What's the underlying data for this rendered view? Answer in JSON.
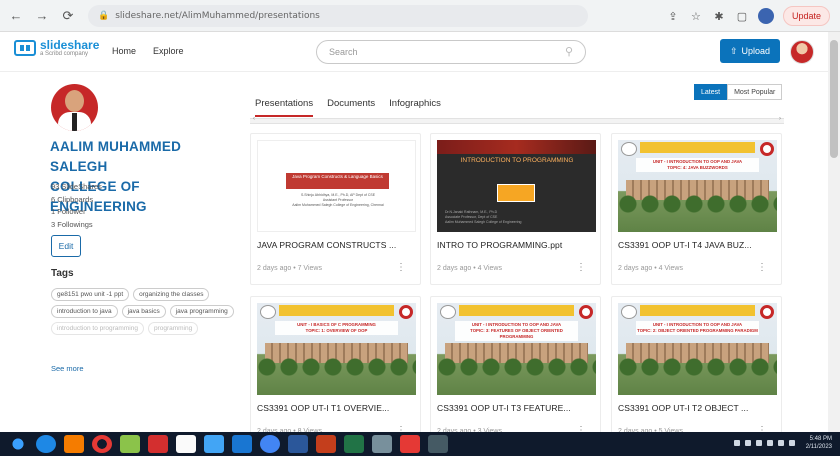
{
  "browser": {
    "url": "slideshare.net/AlimMuhammed/presentations",
    "update_label": "Update"
  },
  "header": {
    "logo_text": "slideshare",
    "logo_sub": "a Scribd company",
    "nav": [
      "Home",
      "Explore"
    ],
    "search_placeholder": "Search",
    "upload_label": "Upload"
  },
  "profile": {
    "name_line1": "AALIM MUHAMMED SALEGH",
    "name_line2": "COLLEGE OF ENGINEERING",
    "stats": [
      "93 SlideShares",
      "6 Clipboards",
      "1 Follower",
      "3 Followings"
    ],
    "edit_label": "Edit",
    "tags_title": "Tags",
    "tags": [
      "ge8151 pwo unit -1 ppt",
      "organizing the classes",
      "introduction to java",
      "java basics",
      "java programming",
      "introduction to programming",
      "programming"
    ],
    "see_more": "See more"
  },
  "tabs": [
    "Presentations",
    "Documents",
    "Infographics"
  ],
  "sort": {
    "latest": "Latest",
    "popular": "Most Popular"
  },
  "cards": [
    {
      "title": "JAVA PROGRAM CONSTRUCTS ...",
      "meta": "2 days ago • 7 Views",
      "thumb_title": "Java Program Constructs & Language Basics",
      "thumb_lines": "S.Shinju Abhidhya, M.E., Ph.D, AP Dept of CSE\nAssistant Professor\nAalim Muhammed Salegh College of Engineering, Chennai"
    },
    {
      "title": "INTRO TO PROGRAMMING.ppt",
      "meta": "2 days ago • 4 Views",
      "thumb_title": "INTRODUCTION TO PROGRAMMING",
      "thumb_lines": "Dr.N.Janaki Rathnam, M.E., Ph.D\nAssociate Professor, Dept of CSE\nAalim Muhammed Salegh College of Engineering"
    },
    {
      "title": "CS3391 OOP UT-I T4 JAVA BUZ...",
      "meta": "2 days ago • 4 Views",
      "thumb_unit": "UNIT - I INTRODUCTION TO OOP AND JAVA\nTOPIC: 4: JAVA BUZZWORDS"
    },
    {
      "title": "CS3391 OOP UT-I T1 OVERVIE...",
      "meta": "2 days ago • 8 Views",
      "thumb_unit": "UNIT - I BASICS OF C PROGRAMMING\nTOPIC: 1: OVERVIEW OF OOP"
    },
    {
      "title": "CS3391 OOP UT-I T3 FEATURE...",
      "meta": "2 days ago • 3 Views",
      "thumb_unit": "UNIT - I INTRODUCTION TO OOP AND JAVA\nTOPIC: 3: FEATURES OF OBJECT ORIENTED PROGRAMMING"
    },
    {
      "title": "CS3391 OOP UT-I T2 OBJECT ...",
      "meta": "2 days ago • 5 Views",
      "thumb_unit": "UNIT - I INTRODUCTION TO OOP AND JAVA\nTOPIC: 2: OBJECT ORIENTED PROGRAMMING PARADIGM"
    }
  ],
  "taskbar": {
    "time": "5:48 PM",
    "date": "2/11/2023"
  }
}
